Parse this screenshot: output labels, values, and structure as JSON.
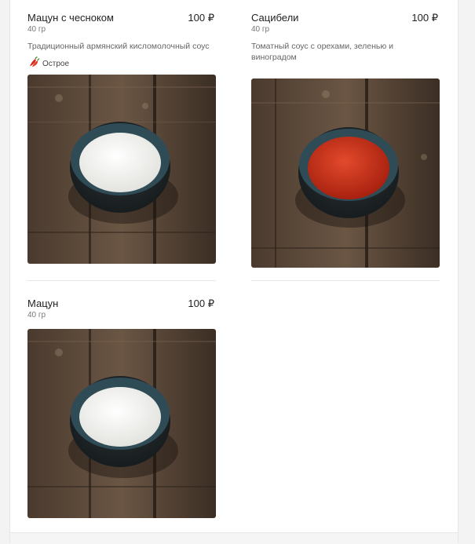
{
  "products": [
    {
      "name": "Мацун с чесноком",
      "weight": "40 гр",
      "price": "100 ₽",
      "description": "Традиционный армянский кисломолочный соус",
      "tag": "Острое",
      "tag_icon": "chili-pepper-icon",
      "sauce_color": "#f2f2ee"
    },
    {
      "name": "Сацибели",
      "weight": "40 гр",
      "price": "100 ₽",
      "description": "Томатный соус с орехами, зеленью и виноградом",
      "sauce_color": "#c8281a"
    },
    {
      "name": "Мацун",
      "weight": "40 гр",
      "price": "100 ₽",
      "sauce_color": "#f2f2ee"
    }
  ]
}
